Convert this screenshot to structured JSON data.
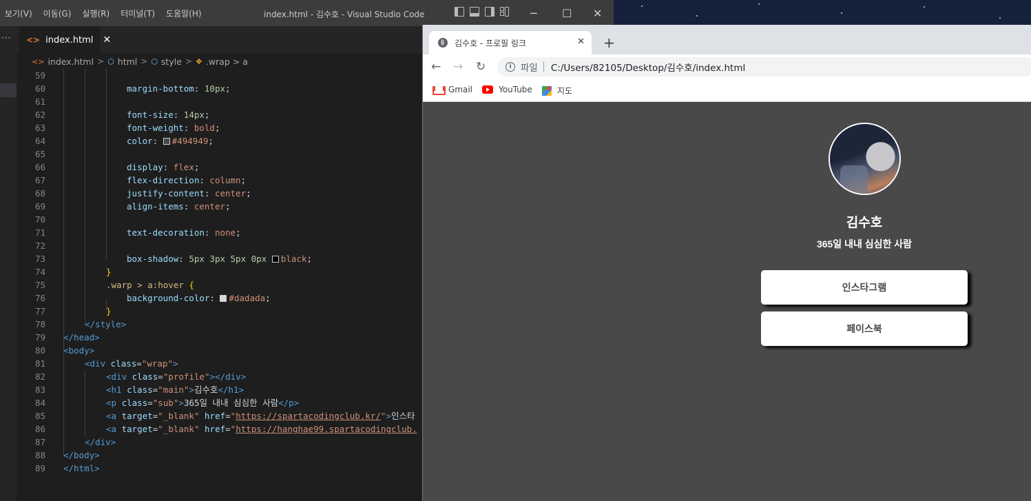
{
  "vscode": {
    "menu": [
      "보기(V)",
      "이동(G)",
      "실행(R)",
      "터미널(T)",
      "도움말(H)"
    ],
    "window_title": "index.html - 김수호 - Visual Studio Code",
    "tab_name": "index.html",
    "breadcrumbs": [
      "index.html",
      "html",
      "style",
      ".wrap > a"
    ]
  },
  "code_lines": [
    {
      "n": "59"
    },
    {
      "n": "60"
    },
    {
      "n": "61"
    },
    {
      "n": "62"
    },
    {
      "n": "63"
    },
    {
      "n": "64"
    },
    {
      "n": "65"
    },
    {
      "n": "66"
    },
    {
      "n": "67"
    },
    {
      "n": "68"
    },
    {
      "n": "69"
    },
    {
      "n": "70"
    },
    {
      "n": "71"
    },
    {
      "n": "72"
    },
    {
      "n": "73"
    },
    {
      "n": "74"
    },
    {
      "n": "75"
    },
    {
      "n": "76"
    },
    {
      "n": "77"
    },
    {
      "n": "78"
    },
    {
      "n": "79"
    },
    {
      "n": "80"
    },
    {
      "n": "81"
    },
    {
      "n": "82"
    },
    {
      "n": "83"
    },
    {
      "n": "84"
    },
    {
      "n": "85"
    },
    {
      "n": "86"
    },
    {
      "n": "87"
    },
    {
      "n": "88"
    },
    {
      "n": "89"
    }
  ],
  "code": {
    "l60": [
      "margin-bottom",
      ": ",
      "10px",
      ";"
    ],
    "l62": [
      "font-size",
      ": ",
      "14px",
      ";"
    ],
    "l63": [
      "font-weight",
      ": ",
      "bold",
      ";"
    ],
    "l64": [
      "color",
      ": ",
      "#494949",
      ";"
    ],
    "l66": [
      "display",
      ": ",
      "flex",
      ";"
    ],
    "l67": [
      "flex-direction",
      ": ",
      "column",
      ";"
    ],
    "l68": [
      "justify-content",
      ": ",
      "center",
      ";"
    ],
    "l69": [
      "align-items",
      ": ",
      "center",
      ";"
    ],
    "l71": [
      "text-decoration",
      ": ",
      "none",
      ";"
    ],
    "l73": [
      "box-shadow",
      ": ",
      "5px 3px 5px 0px",
      "black",
      ";"
    ],
    "l74": "}",
    "l75": [
      ".warp > a:hover",
      "{"
    ],
    "l76": [
      "background-color",
      ": ",
      "#dadada",
      ";"
    ],
    "l77": "}",
    "l78": "</style>",
    "l79": "</head>",
    "l80": "<body>",
    "l81": [
      "<div",
      "class",
      "=",
      "\"wrap\"",
      ">"
    ],
    "l82": [
      "<div",
      "class",
      "=",
      "\"profile\"",
      "></div>"
    ],
    "l83": [
      "<h1",
      "class",
      "=",
      "\"main\"",
      ">",
      "김수호",
      "</h1>"
    ],
    "l84": [
      "<p",
      "class",
      "=",
      "\"sub\"",
      ">",
      "365일 내내 심심한 사람",
      "</p>"
    ],
    "l85": [
      "<a",
      "target",
      "=",
      "\"_blank\"",
      "href",
      "=",
      "\"",
      "https://spartacodingclub.kr/",
      "\"",
      ">",
      "인스타"
    ],
    "l86": [
      "<a",
      "target",
      "=",
      "\"_blank\"",
      "href",
      "=",
      "\"",
      "https://hanghae99.spartacodingclub.",
      ""
    ],
    "l87": "</div>",
    "l88": "</body>",
    "l89": "</html>"
  },
  "chrome": {
    "tab_title": "김수호 - 프로필 링크",
    "scheme": "파일",
    "url": "C:/Users/82105/Desktop/김수호/index.html",
    "bookmarks": [
      "Gmail",
      "YouTube",
      "지도"
    ]
  },
  "profile": {
    "name": "김수호",
    "sub": "365일 내내 심심한 사람",
    "links": [
      "인스타그램",
      "페이스북"
    ],
    "page_bg": "#494949"
  }
}
